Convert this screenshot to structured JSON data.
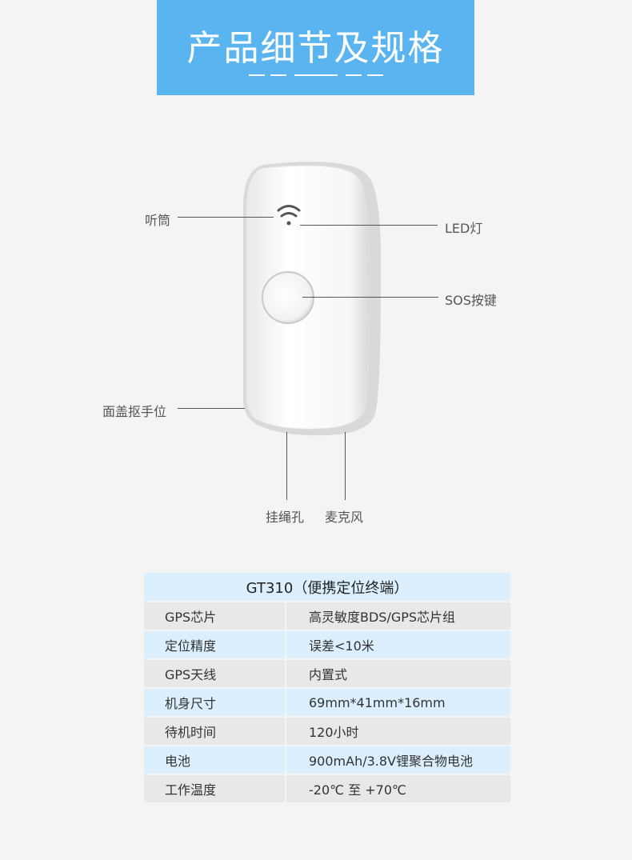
{
  "banner": {
    "title": "产品细节及规格"
  },
  "callouts": {
    "earpiece": "听筒",
    "led": "LED灯",
    "sos": "SOS按键",
    "cover_grip": "面盖抠手位",
    "lanyard": "挂绳孔",
    "mic": "麦克风"
  },
  "spec": {
    "title": "GT310（便携定位终端）",
    "rows": [
      {
        "key": "GPS芯片",
        "value": "高灵敏度BDS/GPS芯片组"
      },
      {
        "key": "定位精度",
        "value": "误差<10米"
      },
      {
        "key": "GPS天线",
        "value": "内置式"
      },
      {
        "key": "机身尺寸",
        "value": "69mm*41mm*16mm"
      },
      {
        "key": "待机时间",
        "value": "120小时"
      },
      {
        "key": "电池",
        "value": "900mAh/3.8V锂聚合物电池"
      },
      {
        "key": "工作温度",
        "value": "-20℃ 至 +70℃"
      }
    ]
  },
  "colors": {
    "banner": "#5ab4f0",
    "row_blue": "#dcefff",
    "row_gray": "#e8e8e8"
  }
}
